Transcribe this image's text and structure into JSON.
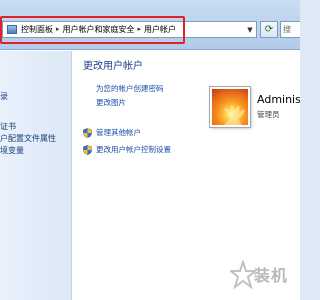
{
  "address": {
    "crumbs": [
      "控制面板",
      "用户帐户和家庭安全",
      "用户帐户"
    ],
    "separator": "▸",
    "dropdown_icon": "chevron-down-icon",
    "refresh_icon": "refresh-icon",
    "search_text": "搜"
  },
  "nav": {
    "items": [
      "",
      "",
      "录",
      "",
      "证书",
      "户配置文件属性",
      "境变量"
    ]
  },
  "content": {
    "title": "更改用户帐户",
    "links": [
      "为您的帐户创建密码",
      "更改图片"
    ],
    "admin_tasks": [
      "管理其他帐户",
      "更改用户帐户控制设置"
    ]
  },
  "user": {
    "name": "Administ",
    "role": "管理员"
  },
  "watermark": {
    "text": "装机"
  },
  "colors": {
    "highlight_border": "#e0202a",
    "link": "#1a4eaa",
    "heading": "#1e3f8a"
  }
}
